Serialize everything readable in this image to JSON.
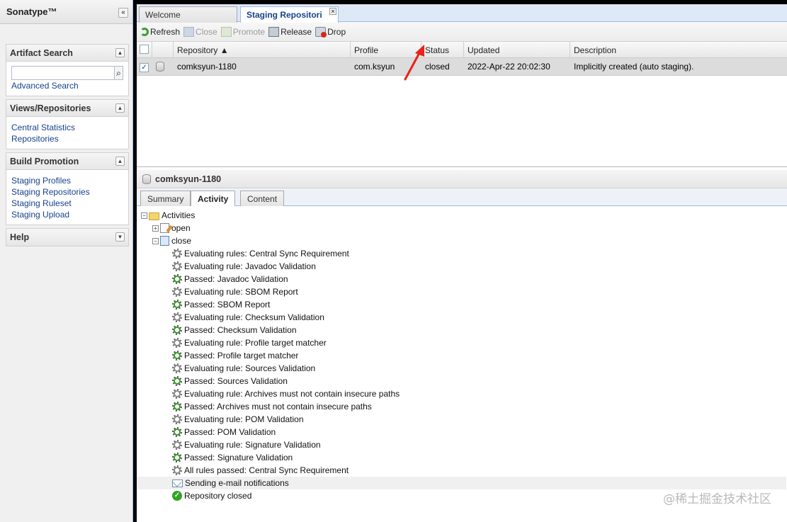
{
  "sidebar": {
    "title": "Sonatype™",
    "collapse_glyph": "«",
    "panels": {
      "artifact_search": {
        "title": "Artifact Search",
        "search_placeholder": "",
        "advanced_link": "Advanced Search"
      },
      "views": {
        "title": "Views/Repositories",
        "links": [
          "Central Statistics",
          "Repositories"
        ]
      },
      "build_promotion": {
        "title": "Build Promotion",
        "links": [
          "Staging Profiles",
          "Staging Repositories",
          "Staging Ruleset",
          "Staging Upload"
        ]
      },
      "help": {
        "title": "Help"
      }
    }
  },
  "tabs": {
    "welcome": "Welcome",
    "staging": "Staging Repositori"
  },
  "toolbar": {
    "refresh": "Refresh",
    "close": "Close",
    "promote": "Promote",
    "release": "Release",
    "drop": "Drop"
  },
  "grid": {
    "columns": [
      "Repository ▲",
      "Profile",
      "Status",
      "Updated",
      "Description"
    ],
    "rows": [
      {
        "checked": "✓",
        "repository": "comksyun-1180",
        "profile": "com.ksyun",
        "status": "closed",
        "updated": "2022-Apr-22 20:02:30",
        "description": "Implicitly created (auto staging)."
      }
    ]
  },
  "detail": {
    "title": "comksyun-1180",
    "tabs": [
      "Summary",
      "Activity",
      "Content"
    ],
    "active_tab": "Activity"
  },
  "tree": {
    "root": "Activities",
    "open_node": "open",
    "close_node": "close",
    "events": [
      {
        "icon": "gears-icon",
        "text": "Evaluating rules: Central Sync Requirement"
      },
      {
        "icon": "gear-icon",
        "text": "Evaluating rule: Javadoc Validation"
      },
      {
        "icon": "gear-pass-icon",
        "text": "Passed: Javadoc Validation"
      },
      {
        "icon": "gear-icon",
        "text": "Evaluating rule: SBOM Report"
      },
      {
        "icon": "gear-pass-icon",
        "text": "Passed: SBOM Report"
      },
      {
        "icon": "gear-icon",
        "text": "Evaluating rule: Checksum Validation"
      },
      {
        "icon": "gear-pass-icon",
        "text": "Passed: Checksum Validation"
      },
      {
        "icon": "gear-icon",
        "text": "Evaluating rule: Profile target matcher"
      },
      {
        "icon": "gear-pass-icon",
        "text": "Passed: Profile target matcher"
      },
      {
        "icon": "gear-icon",
        "text": "Evaluating rule: Sources Validation"
      },
      {
        "icon": "gear-pass-icon",
        "text": "Passed: Sources Validation"
      },
      {
        "icon": "gear-icon",
        "text": "Evaluating rule: Archives must not contain insecure paths"
      },
      {
        "icon": "gear-pass-icon",
        "text": "Passed: Archives must not contain insecure paths"
      },
      {
        "icon": "gear-icon",
        "text": "Evaluating rule: POM Validation"
      },
      {
        "icon": "gear-pass-icon",
        "text": "Passed: POM Validation"
      },
      {
        "icon": "gear-icon",
        "text": "Evaluating rule: Signature Validation"
      },
      {
        "icon": "gear-pass-icon",
        "text": "Passed: Signature Validation"
      },
      {
        "icon": "gears-icon",
        "text": "All rules passed: Central Sync Requirement"
      },
      {
        "icon": "mail-icon",
        "text": "Sending e-mail notifications"
      },
      {
        "icon": "check-circle-icon",
        "text": "Repository closed"
      }
    ]
  },
  "watermark": "@稀土掘金技术社区",
  "colors": {
    "link": "#15428b",
    "arrow": "#e8231b",
    "row_selected": "#dcdcdc"
  }
}
